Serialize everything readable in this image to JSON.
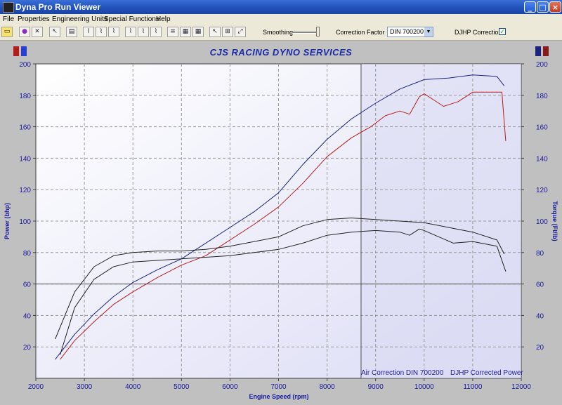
{
  "window": {
    "title": "Dyna Pro Run Viewer"
  },
  "menu": [
    "File",
    "Properties",
    "Engineering Units",
    "Special Functions",
    "Help"
  ],
  "toolbar": {
    "smoothing_label": "Smoothing",
    "correction_factor_label": "Correction Factor",
    "correction_factor_value": "DIN 700200",
    "djhp_label": "DJHP Correction",
    "djhp_checked": true
  },
  "colors": {
    "power": "#1a237e",
    "torque": "#b71c1c",
    "envelope": "#222222",
    "axis_text": "#1a1aa0"
  },
  "chart_data": {
    "type": "line",
    "title": "CJS RACING DYNO SERVICES",
    "xlabel": "Engine Speed (rpm)",
    "ylabel_left": "Power (bhp)",
    "ylabel_right": "Torque (Ft/lb)",
    "xlim": [
      2000,
      12000
    ],
    "ylim": [
      0,
      200
    ],
    "xticks": [
      2000,
      3000,
      4000,
      5000,
      6000,
      7000,
      8000,
      9000,
      10000,
      11000,
      12000
    ],
    "yticks": [
      20,
      40,
      60,
      80,
      100,
      120,
      140,
      160,
      180,
      200
    ],
    "grid": true,
    "cursor_rpm": 8700,
    "reference_line": 60,
    "footer_left": "Air Correction DIN 700200",
    "footer_right": "DJHP Corrected Power",
    "series": [
      {
        "color": "#1a237e",
        "x": [
          2400,
          2800,
          3200,
          3600,
          4000,
          4500,
          5000,
          5500,
          6000,
          6500,
          7000,
          7500,
          8000,
          8500,
          9000,
          9500,
          10000,
          10500,
          11000,
          11500,
          11650
        ],
        "y": [
          12,
          28,
          41,
          52,
          61,
          69,
          76,
          86,
          96,
          106,
          118,
          136,
          152,
          165,
          175,
          184,
          190,
          191,
          193,
          192,
          186
        ]
      },
      {
        "color": "#b71c1c",
        "x": [
          2500,
          2800,
          3200,
          3600,
          4000,
          4500,
          5000,
          5500,
          6000,
          6500,
          7000,
          7500,
          8000,
          8500,
          8900,
          9200,
          9500,
          9700,
          9900,
          10000,
          10200,
          10400,
          10700,
          11000,
          11600,
          11680
        ],
        "y": [
          12,
          24,
          36,
          47,
          55,
          64,
          72,
          78,
          88,
          98,
          109,
          124,
          141,
          153,
          160,
          167,
          170,
          168,
          179,
          181,
          177,
          173,
          176,
          182,
          182,
          151
        ]
      },
      {
        "color": "#222222",
        "x": [
          2400,
          2800,
          3200,
          3600,
          4000,
          4500,
          5000,
          5500,
          6000,
          6500,
          7000,
          7500,
          8000,
          8500,
          9000,
          9500,
          10000,
          10500,
          11000,
          11500,
          11650
        ],
        "y": [
          25,
          55,
          71,
          78,
          80,
          81,
          81,
          82,
          84,
          87,
          90,
          97,
          101,
          102,
          101,
          100,
          99,
          96,
          93,
          88,
          79
        ]
      },
      {
        "color": "#222222",
        "x": [
          2500,
          2800,
          3200,
          3600,
          4000,
          4500,
          5000,
          5500,
          6000,
          6500,
          7000,
          7500,
          8000,
          8500,
          9000,
          9500,
          9700,
          9900,
          10000,
          10300,
          10600,
          11000,
          11500,
          11680
        ],
        "y": [
          15,
          45,
          63,
          71,
          74,
          75,
          76,
          77,
          78,
          80,
          82,
          86,
          91,
          93,
          94,
          93,
          91,
          95,
          94,
          90,
          86,
          87,
          84,
          68
        ]
      }
    ]
  }
}
